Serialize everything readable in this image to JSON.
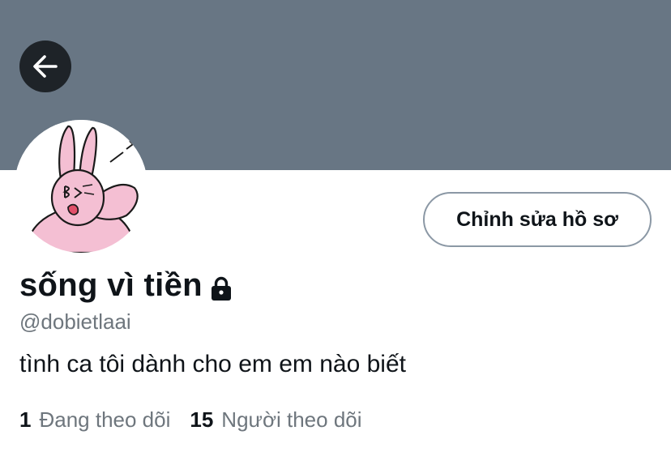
{
  "header": {
    "banner_color": "#687684",
    "back_icon": "arrow-left-icon"
  },
  "profile": {
    "display_name": "sống vì tiền",
    "protected_icon": "lock-icon",
    "handle": "@dobietlaai",
    "bio": "tình ca tôi dành cho em em nào biết",
    "edit_button_label": "Chỉnh sửa hồ sơ",
    "following_count": "1",
    "following_label": "Đang theo dõi",
    "followers_count": "15",
    "followers_label": "Người theo dõi"
  },
  "colors": {
    "text_primary": "#0f1419",
    "text_secondary": "#6e767d",
    "button_border": "#8b98a5",
    "avatar_bunny": "#f4bfd3"
  }
}
